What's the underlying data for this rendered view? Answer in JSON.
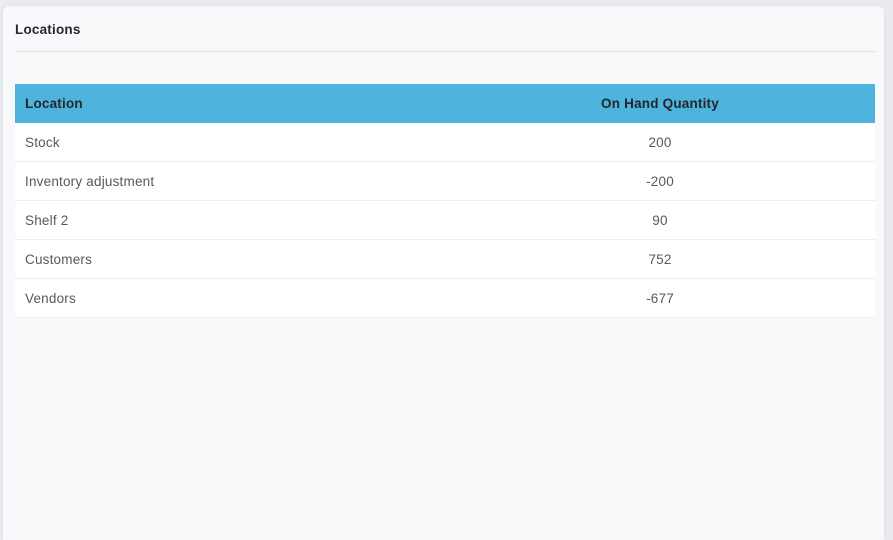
{
  "panel": {
    "title": "Locations"
  },
  "table": {
    "columns": [
      {
        "label": "Location",
        "align": "left"
      },
      {
        "label": "On Hand Quantity",
        "align": "center"
      }
    ],
    "rows": [
      {
        "location": "Stock",
        "on_hand_quantity": "200"
      },
      {
        "location": "Inventory adjustment",
        "on_hand_quantity": "-200"
      },
      {
        "location": "Shelf 2",
        "on_hand_quantity": "90"
      },
      {
        "location": "Customers",
        "on_hand_quantity": "752"
      },
      {
        "location": "Vendors",
        "on_hand_quantity": "-677"
      }
    ]
  },
  "colors": {
    "header_bg": "#4fb4dd",
    "header_text": "#23262a",
    "row_text": "#55595e",
    "card_bg": "#f8f9fb",
    "page_bg": "#e9ebee"
  }
}
